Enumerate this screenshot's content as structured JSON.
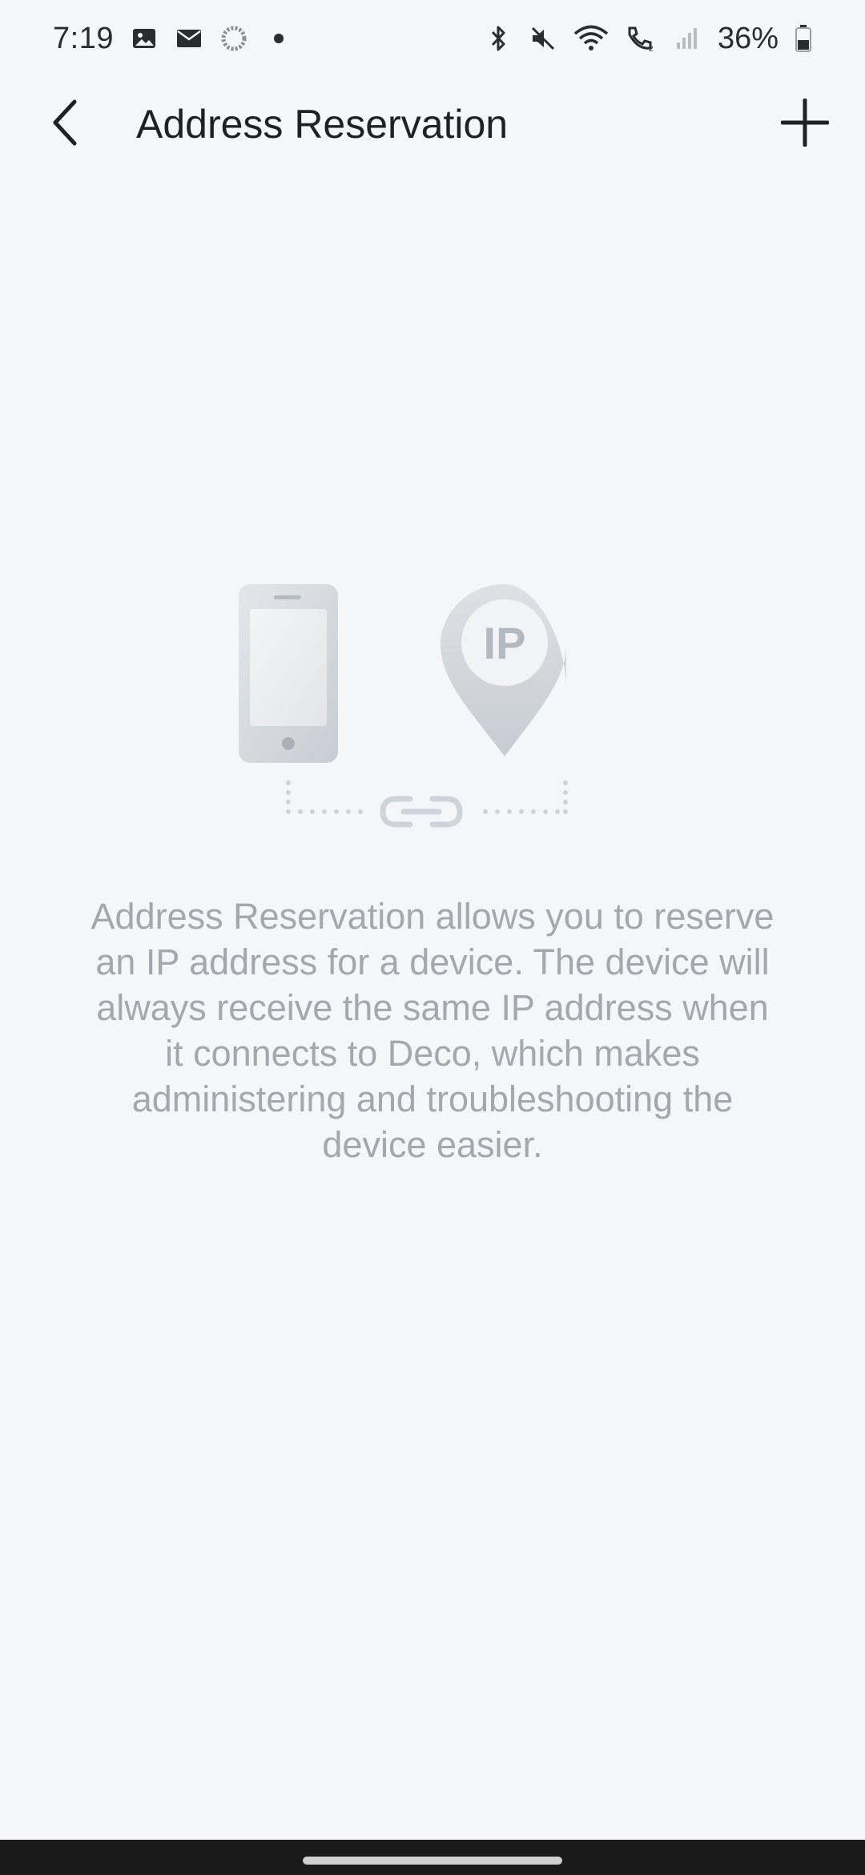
{
  "status_bar": {
    "time": "7:19",
    "left_icons": [
      "photo-icon",
      "mail-icon",
      "sync-icon",
      "dot-icon"
    ],
    "right_icons": [
      "bluetooth-icon",
      "mute-icon",
      "wifi-icon",
      "wifi-calling-icon",
      "signal-icon",
      "battery-icon"
    ],
    "battery": "36%"
  },
  "app_bar": {
    "title": "Address Reservation",
    "back_icon": "chevron-left-icon",
    "add_icon": "plus-icon"
  },
  "illustration": {
    "ip_label": "IP"
  },
  "description": "Address Reservation allows you to reserve an IP address for a device. The device will always receive the same IP address when it connects to Deco, which makes administering and troubleshooting the device easier.",
  "colors": {
    "background": "#f4f6fa",
    "illustration_gray": "#cfd4da",
    "text_muted": "#a4a8ae"
  }
}
